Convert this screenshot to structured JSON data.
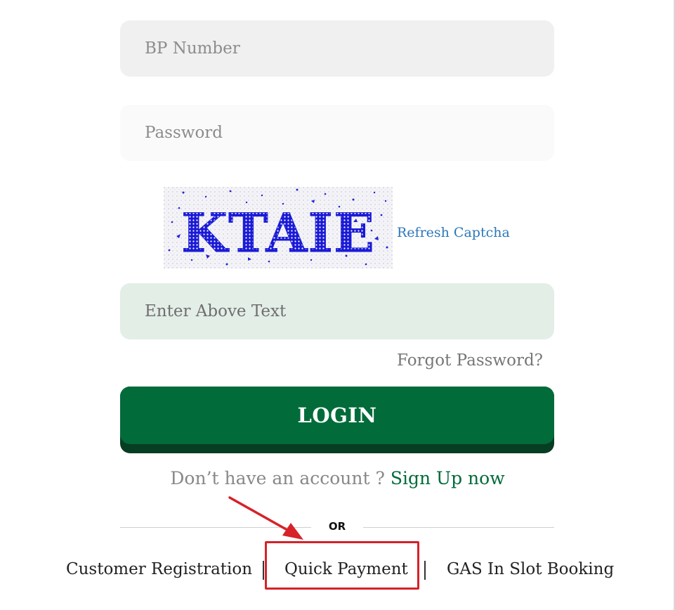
{
  "form": {
    "bp_placeholder": "BP Number",
    "password_placeholder": "Password",
    "captcha_text": "KTAIE",
    "refresh_label": "Refresh Captcha",
    "captcha_placeholder": "Enter Above Text",
    "forgot_label": "Forgot Password?",
    "login_label": "LOGIN"
  },
  "signup": {
    "prompt": "Don’t have an account ? ",
    "link_label": "Sign Up now"
  },
  "divider": {
    "or_label": "OR"
  },
  "bottom_links": {
    "customer_registration": "Customer Registration",
    "quick_payment": "Quick Payment",
    "gas_slot_booking": "GAS In Slot Booking"
  },
  "colors": {
    "brand_green": "#016b3a",
    "brand_green_dark": "#063d23",
    "link_blue": "#2c77b8",
    "annotation_red": "#d62228"
  }
}
